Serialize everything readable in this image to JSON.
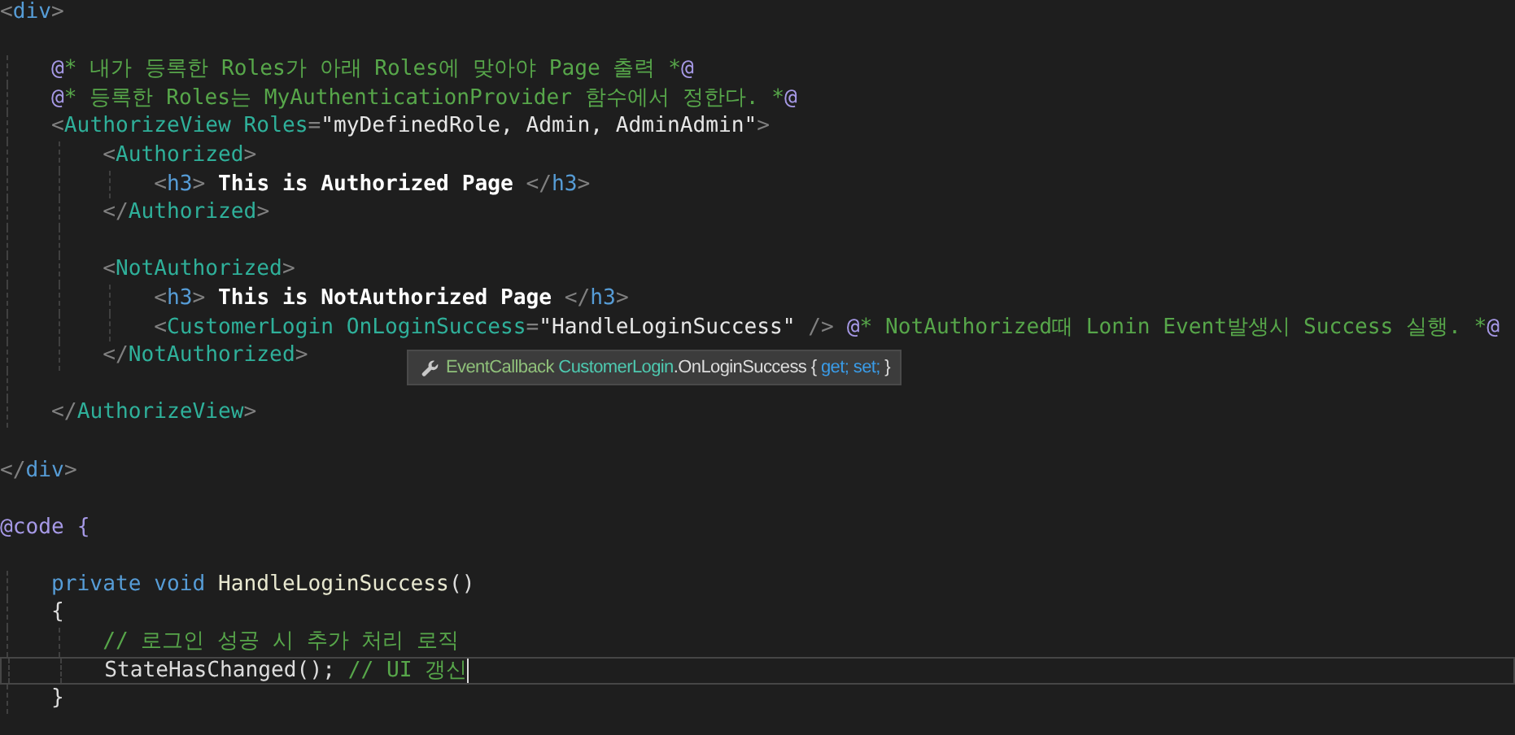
{
  "editor": {
    "lines": [
      {
        "current": false,
        "tokens": [
          {
            "kind": "punct",
            "text": "<"
          },
          {
            "kind": "html",
            "text": "div"
          },
          {
            "kind": "punct",
            "text": ">"
          }
        ]
      },
      {
        "current": false
      },
      {
        "current": false,
        "tokens": [
          {
            "kind": "razor",
            "text": "    @"
          },
          {
            "kind": "comment",
            "text": "* 내가 등록한 Roles가 아래 Roles에 맞아야 Page 출력 *"
          },
          {
            "kind": "razor",
            "text": "@"
          }
        ]
      },
      {
        "current": false,
        "tokens": [
          {
            "kind": "razor",
            "text": "    @"
          },
          {
            "kind": "comment",
            "text": "* 등록한 Roles는 MyAuthenticationProvider 함수에서 정한다. *"
          },
          {
            "kind": "razor",
            "text": "@"
          }
        ]
      },
      {
        "current": false,
        "tokens": [
          {
            "kind": "punct",
            "text": "    <"
          },
          {
            "kind": "component",
            "text": "AuthorizeView "
          },
          {
            "kind": "component",
            "text": "Roles"
          },
          {
            "kind": "punct",
            "text": "="
          },
          {
            "kind": "string",
            "text": "\"myDefinedRole, Admin, AdminAdmin\""
          },
          {
            "kind": "punct",
            "text": ">"
          }
        ]
      },
      {
        "current": false,
        "tokens": [
          {
            "kind": "punct",
            "text": "        <"
          },
          {
            "kind": "component",
            "text": "Authorized"
          },
          {
            "kind": "punct",
            "text": ">"
          }
        ]
      },
      {
        "current": false,
        "tokens": [
          {
            "kind": "punct",
            "text": "            <"
          },
          {
            "kind": "html",
            "text": "h3"
          },
          {
            "kind": "punct",
            "text": ">"
          },
          {
            "kind": "bold",
            "text": " This is Authorized Page "
          },
          {
            "kind": "punct",
            "text": "</"
          },
          {
            "kind": "html",
            "text": "h3"
          },
          {
            "kind": "punct",
            "text": ">"
          }
        ]
      },
      {
        "current": false,
        "tokens": [
          {
            "kind": "punct",
            "text": "        </"
          },
          {
            "kind": "component",
            "text": "Authorized"
          },
          {
            "kind": "punct",
            "text": ">"
          }
        ]
      },
      {
        "current": false
      },
      {
        "current": false,
        "tokens": [
          {
            "kind": "punct",
            "text": "        <"
          },
          {
            "kind": "component",
            "text": "NotAuthorized"
          },
          {
            "kind": "punct",
            "text": ">"
          }
        ]
      },
      {
        "current": false,
        "tokens": [
          {
            "kind": "punct",
            "text": "            <"
          },
          {
            "kind": "html",
            "text": "h3"
          },
          {
            "kind": "punct",
            "text": ">"
          },
          {
            "kind": "bold",
            "text": " This is NotAuthorized Page "
          },
          {
            "kind": "punct",
            "text": "</"
          },
          {
            "kind": "html",
            "text": "h3"
          },
          {
            "kind": "punct",
            "text": ">"
          }
        ]
      },
      {
        "current": false,
        "tokens": [
          {
            "kind": "punct",
            "text": "            <"
          },
          {
            "kind": "component",
            "text": "CustomerLogin "
          },
          {
            "kind": "component",
            "text": "OnLoginSuccess"
          },
          {
            "kind": "punct",
            "text": "="
          },
          {
            "kind": "string",
            "text": "\"HandleLoginSuccess\" "
          },
          {
            "kind": "punct",
            "text": "/> "
          },
          {
            "kind": "razor",
            "text": "@"
          },
          {
            "kind": "comment",
            "text": "* NotAuthorized때 Lonin Event발생시 Success 실행. *"
          },
          {
            "kind": "razor",
            "text": "@"
          }
        ]
      },
      {
        "current": false,
        "tokens": [
          {
            "kind": "punct",
            "text": "        </"
          },
          {
            "kind": "component",
            "text": "NotAuthorized"
          },
          {
            "kind": "punct",
            "text": ">"
          }
        ]
      },
      {
        "current": false
      },
      {
        "current": false,
        "tokens": [
          {
            "kind": "punct",
            "text": "    </"
          },
          {
            "kind": "component",
            "text": "AuthorizeView"
          },
          {
            "kind": "punct",
            "text": ">"
          }
        ]
      },
      {
        "current": false
      },
      {
        "current": false,
        "tokens": [
          {
            "kind": "punct",
            "text": "</"
          },
          {
            "kind": "html",
            "text": "div"
          },
          {
            "kind": "punct",
            "text": ">"
          }
        ]
      },
      {
        "current": false
      },
      {
        "current": false,
        "tokens": [
          {
            "kind": "razor",
            "text": "@code "
          },
          {
            "kind": "razor",
            "text": "{"
          }
        ]
      },
      {
        "current": false
      },
      {
        "current": false,
        "tokens": [
          {
            "kind": "keyword",
            "text": "    private "
          },
          {
            "kind": "keyword",
            "text": "void "
          },
          {
            "kind": "method",
            "text": "HandleLoginSuccess"
          },
          {
            "kind": "plain",
            "text": "()"
          }
        ]
      },
      {
        "current": false,
        "tokens": [
          {
            "kind": "plain",
            "text": "    {"
          }
        ]
      },
      {
        "current": false,
        "tokens": [
          {
            "kind": "comment",
            "text": "        // 로그인 성공 시 추가 처리 로직"
          }
        ]
      },
      {
        "current": true,
        "tokens": [
          {
            "kind": "plain",
            "text": "        StateHasChanged(); "
          },
          {
            "kind": "comment",
            "text": "// UI 갱신"
          }
        ]
      },
      {
        "current": false,
        "tokens": [
          {
            "kind": "plain",
            "text": "    }"
          }
        ]
      }
    ]
  },
  "tooltip": {
    "tokens": [
      {
        "kind": "type",
        "text": "EventCallback "
      },
      {
        "kind": "class",
        "text": "CustomerLogin"
      },
      {
        "kind": "plain",
        "text": ".OnLoginSuccess { "
      },
      {
        "kind": "keyword",
        "text": "get; "
      },
      {
        "kind": "keyword",
        "text": "set;"
      },
      {
        "kind": "plain",
        "text": " }"
      }
    ]
  }
}
